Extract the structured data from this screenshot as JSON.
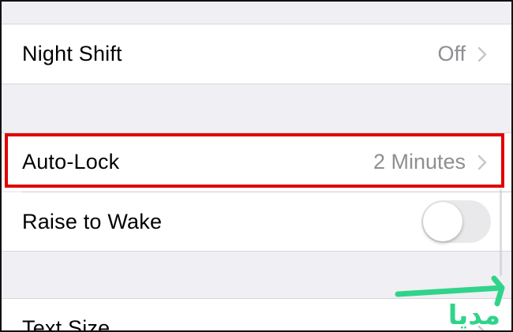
{
  "settings": {
    "night_shift": {
      "label": "Night Shift",
      "value": "Off"
    },
    "auto_lock": {
      "label": "Auto-Lock",
      "value": "2 Minutes"
    },
    "raise_to_wake": {
      "label": "Raise to Wake",
      "enabled": false
    },
    "text_size": {
      "label": "Text Size"
    }
  },
  "icons": {
    "chevron": "chevron-right-icon",
    "watermark": "logo"
  },
  "colors": {
    "background": "#efeff4",
    "highlight": "#e00000",
    "value_gray": "#8e8e93",
    "watermark_green": "#2fd48a"
  },
  "watermark": {
    "text": "مدیا"
  }
}
